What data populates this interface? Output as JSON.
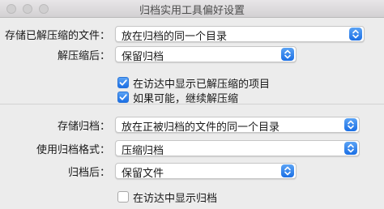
{
  "window": {
    "title": "归档实用工具偏好设置"
  },
  "unarchive": {
    "save_label": "存储已解压缩的文件：",
    "save_value": "放在归档的同一个目录",
    "after_label": "解压缩后：",
    "after_value": "保留归档",
    "reveal_label": "在访达中显示已解压缩的项目",
    "reveal_checked": true,
    "continue_label": "如果可能，继续解压缩",
    "continue_checked": true
  },
  "archive": {
    "save_label": "存储归档：",
    "save_value": "放在正被归档的文件的同一个目录",
    "format_label": "使用归档格式：",
    "format_value": "压缩归档",
    "after_label": "归档后：",
    "after_value": "保留文件",
    "reveal_label": "在访达中显示归档",
    "reveal_checked": false
  },
  "colors": {
    "accent": "#1b6fe5",
    "window_bg": "#ececec"
  }
}
